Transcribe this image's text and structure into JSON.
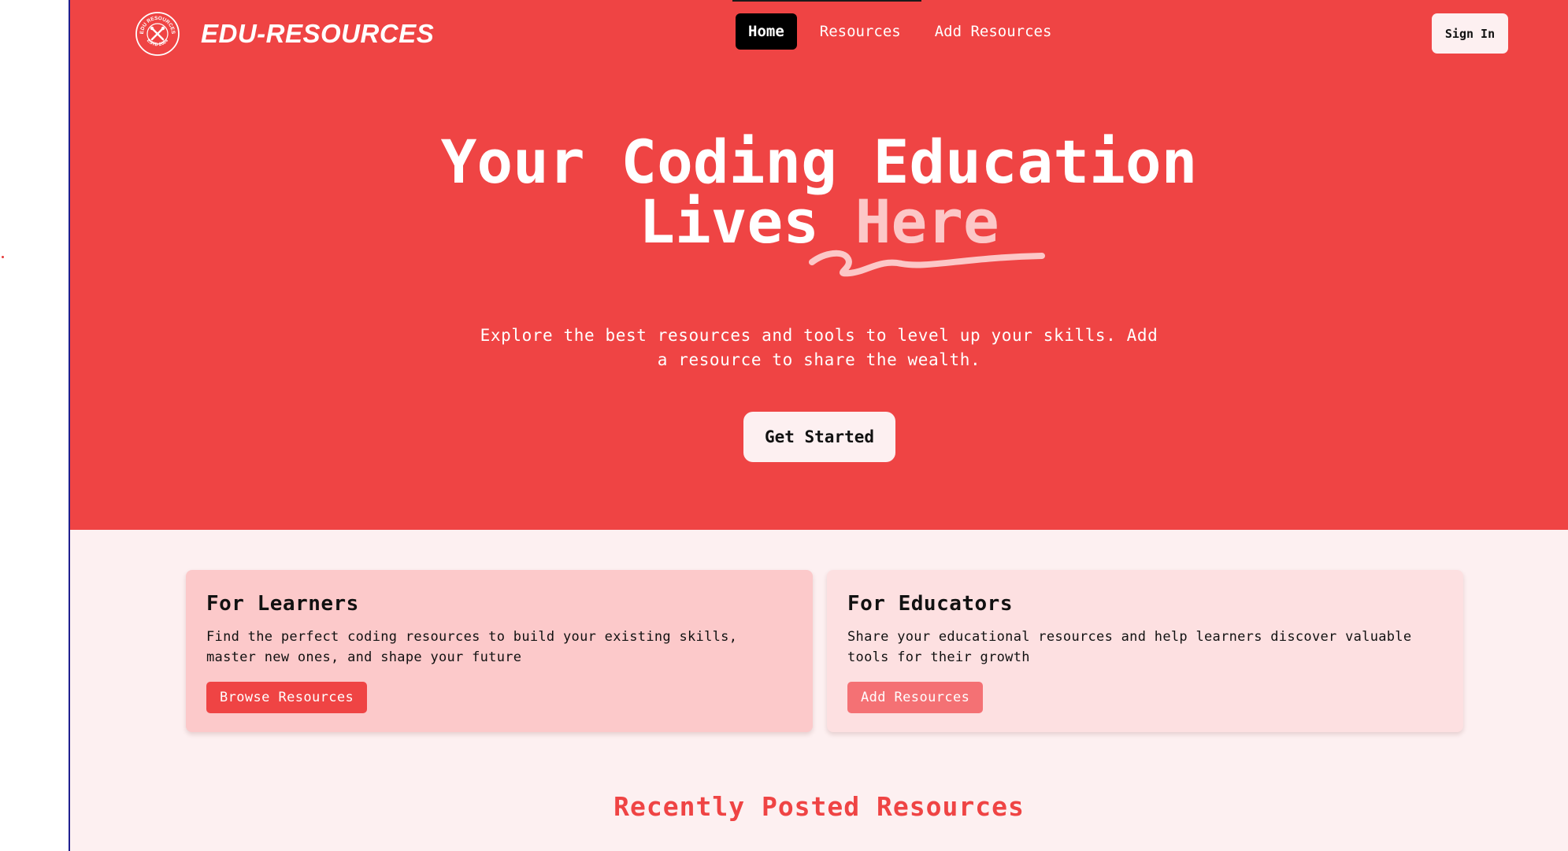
{
  "brand": {
    "name": "EDU-RESOURCES",
    "logo_text_top": "EDU RESOURCES",
    "logo_text_bottom": "ESTD 2024",
    "logo_icon": "crossed-tools-icon"
  },
  "nav": {
    "items": [
      {
        "label": "Home",
        "active": true
      },
      {
        "label": "Resources",
        "active": false
      },
      {
        "label": "Add Resources",
        "active": false
      }
    ],
    "sign_in": "Sign In"
  },
  "hero": {
    "headline_line1": "Your Coding Education",
    "headline_line2_prefix": "Lives",
    "headline_line2_accent": "Here",
    "subtext": "Explore the best resources and tools to level up your skills. Add a resource to share the wealth.",
    "cta": "Get Started"
  },
  "cards": {
    "learners": {
      "title": "For Learners",
      "text": "Find the perfect coding resources to build your existing skills, master new ones, and shape your future",
      "button": "Browse Resources"
    },
    "educators": {
      "title": "For Educators",
      "text": "Share your educational resources and help learners discover valuable tools for their growth",
      "button": "Add Resources"
    }
  },
  "recent": {
    "title": "Recently Posted Resources"
  },
  "colors": {
    "primary": "#ef4444",
    "accent_light": "#fcc7c7",
    "background": "#fdf0f1",
    "card_learners": "#fcc9ca",
    "card_educators": "#fde0e1",
    "educator_button": "#f47174"
  }
}
